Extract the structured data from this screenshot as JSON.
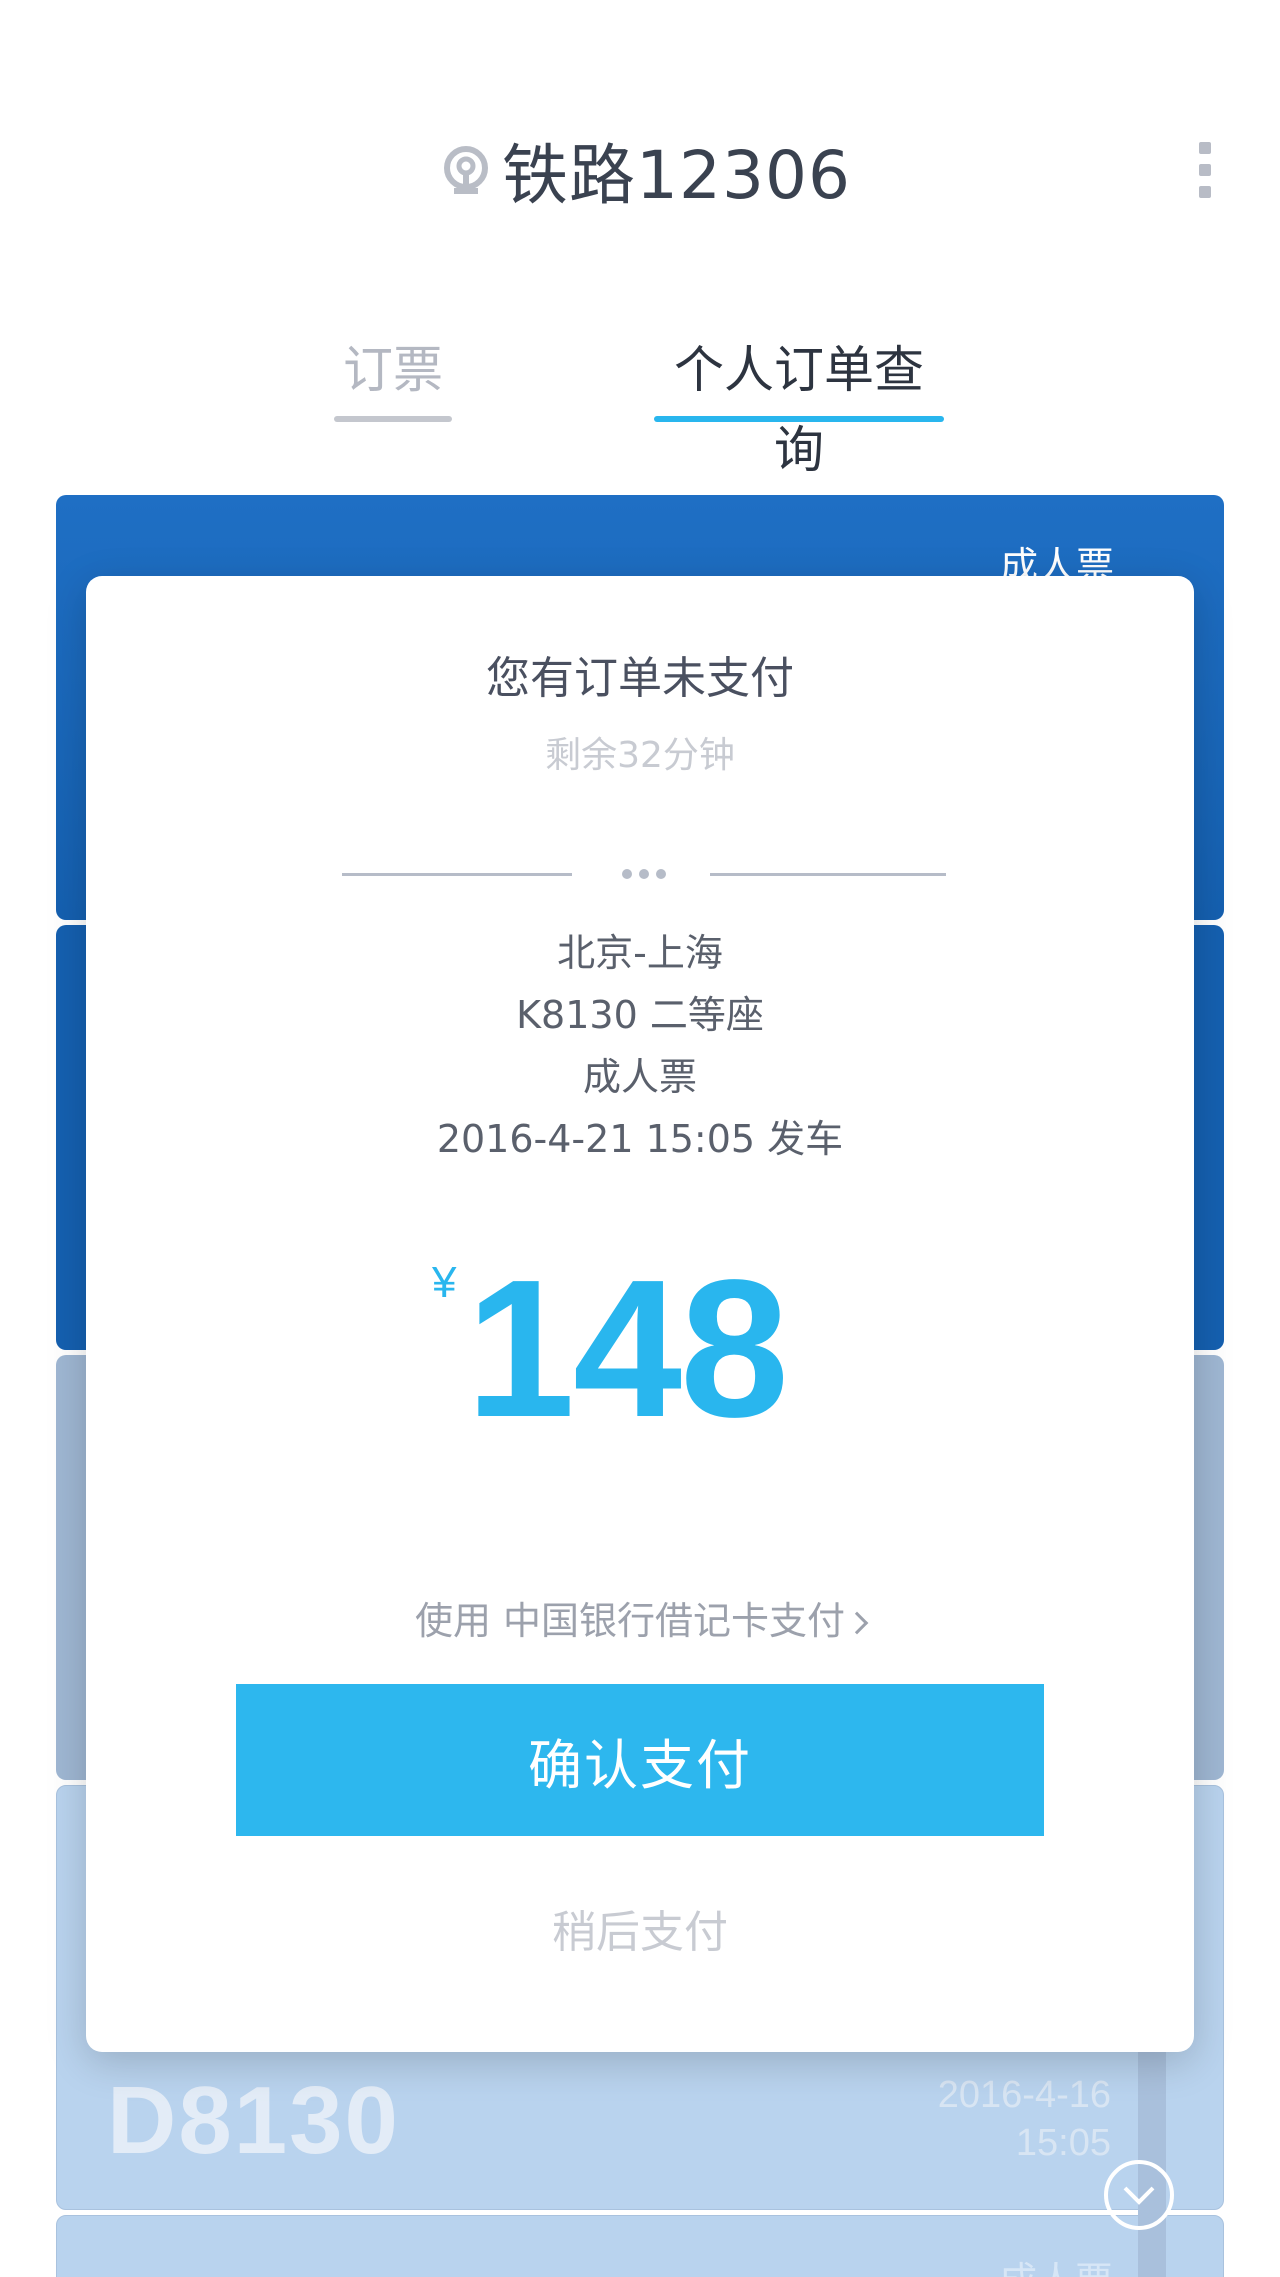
{
  "header": {
    "app_title": "铁路12306",
    "logo_icon": "railway-logo-icon",
    "more_icon": "more-vertical-icon"
  },
  "tabs": [
    {
      "label": "订票",
      "active": false
    },
    {
      "label": "个人订单查询",
      "active": true
    }
  ],
  "background_tickets": [
    {
      "ticket_type": "成人票"
    },
    {
      "ticket_type": ""
    },
    {
      "ticket_type": ""
    },
    {
      "train_no": "D8130",
      "date": "2016-4-16",
      "time": "15:05"
    },
    {
      "ticket_type": "成人票"
    }
  ],
  "modal": {
    "title": "您有订单未支付",
    "countdown": "剩余32分钟",
    "route": "北京-上海",
    "train_seat": "K8130 二等座",
    "ticket_type": "成人票",
    "departure": "2016-4-21 15:05 发车",
    "currency_symbol": "¥",
    "price": "148",
    "pay_method": "使用 中国银行借记卡支付",
    "confirm_label": "确认支付",
    "later_label": "稍后支付"
  },
  "colors": {
    "accent": "#29b6ee",
    "ticket_dark": "#1560b0",
    "ticket_light": "#b9d3ee"
  }
}
